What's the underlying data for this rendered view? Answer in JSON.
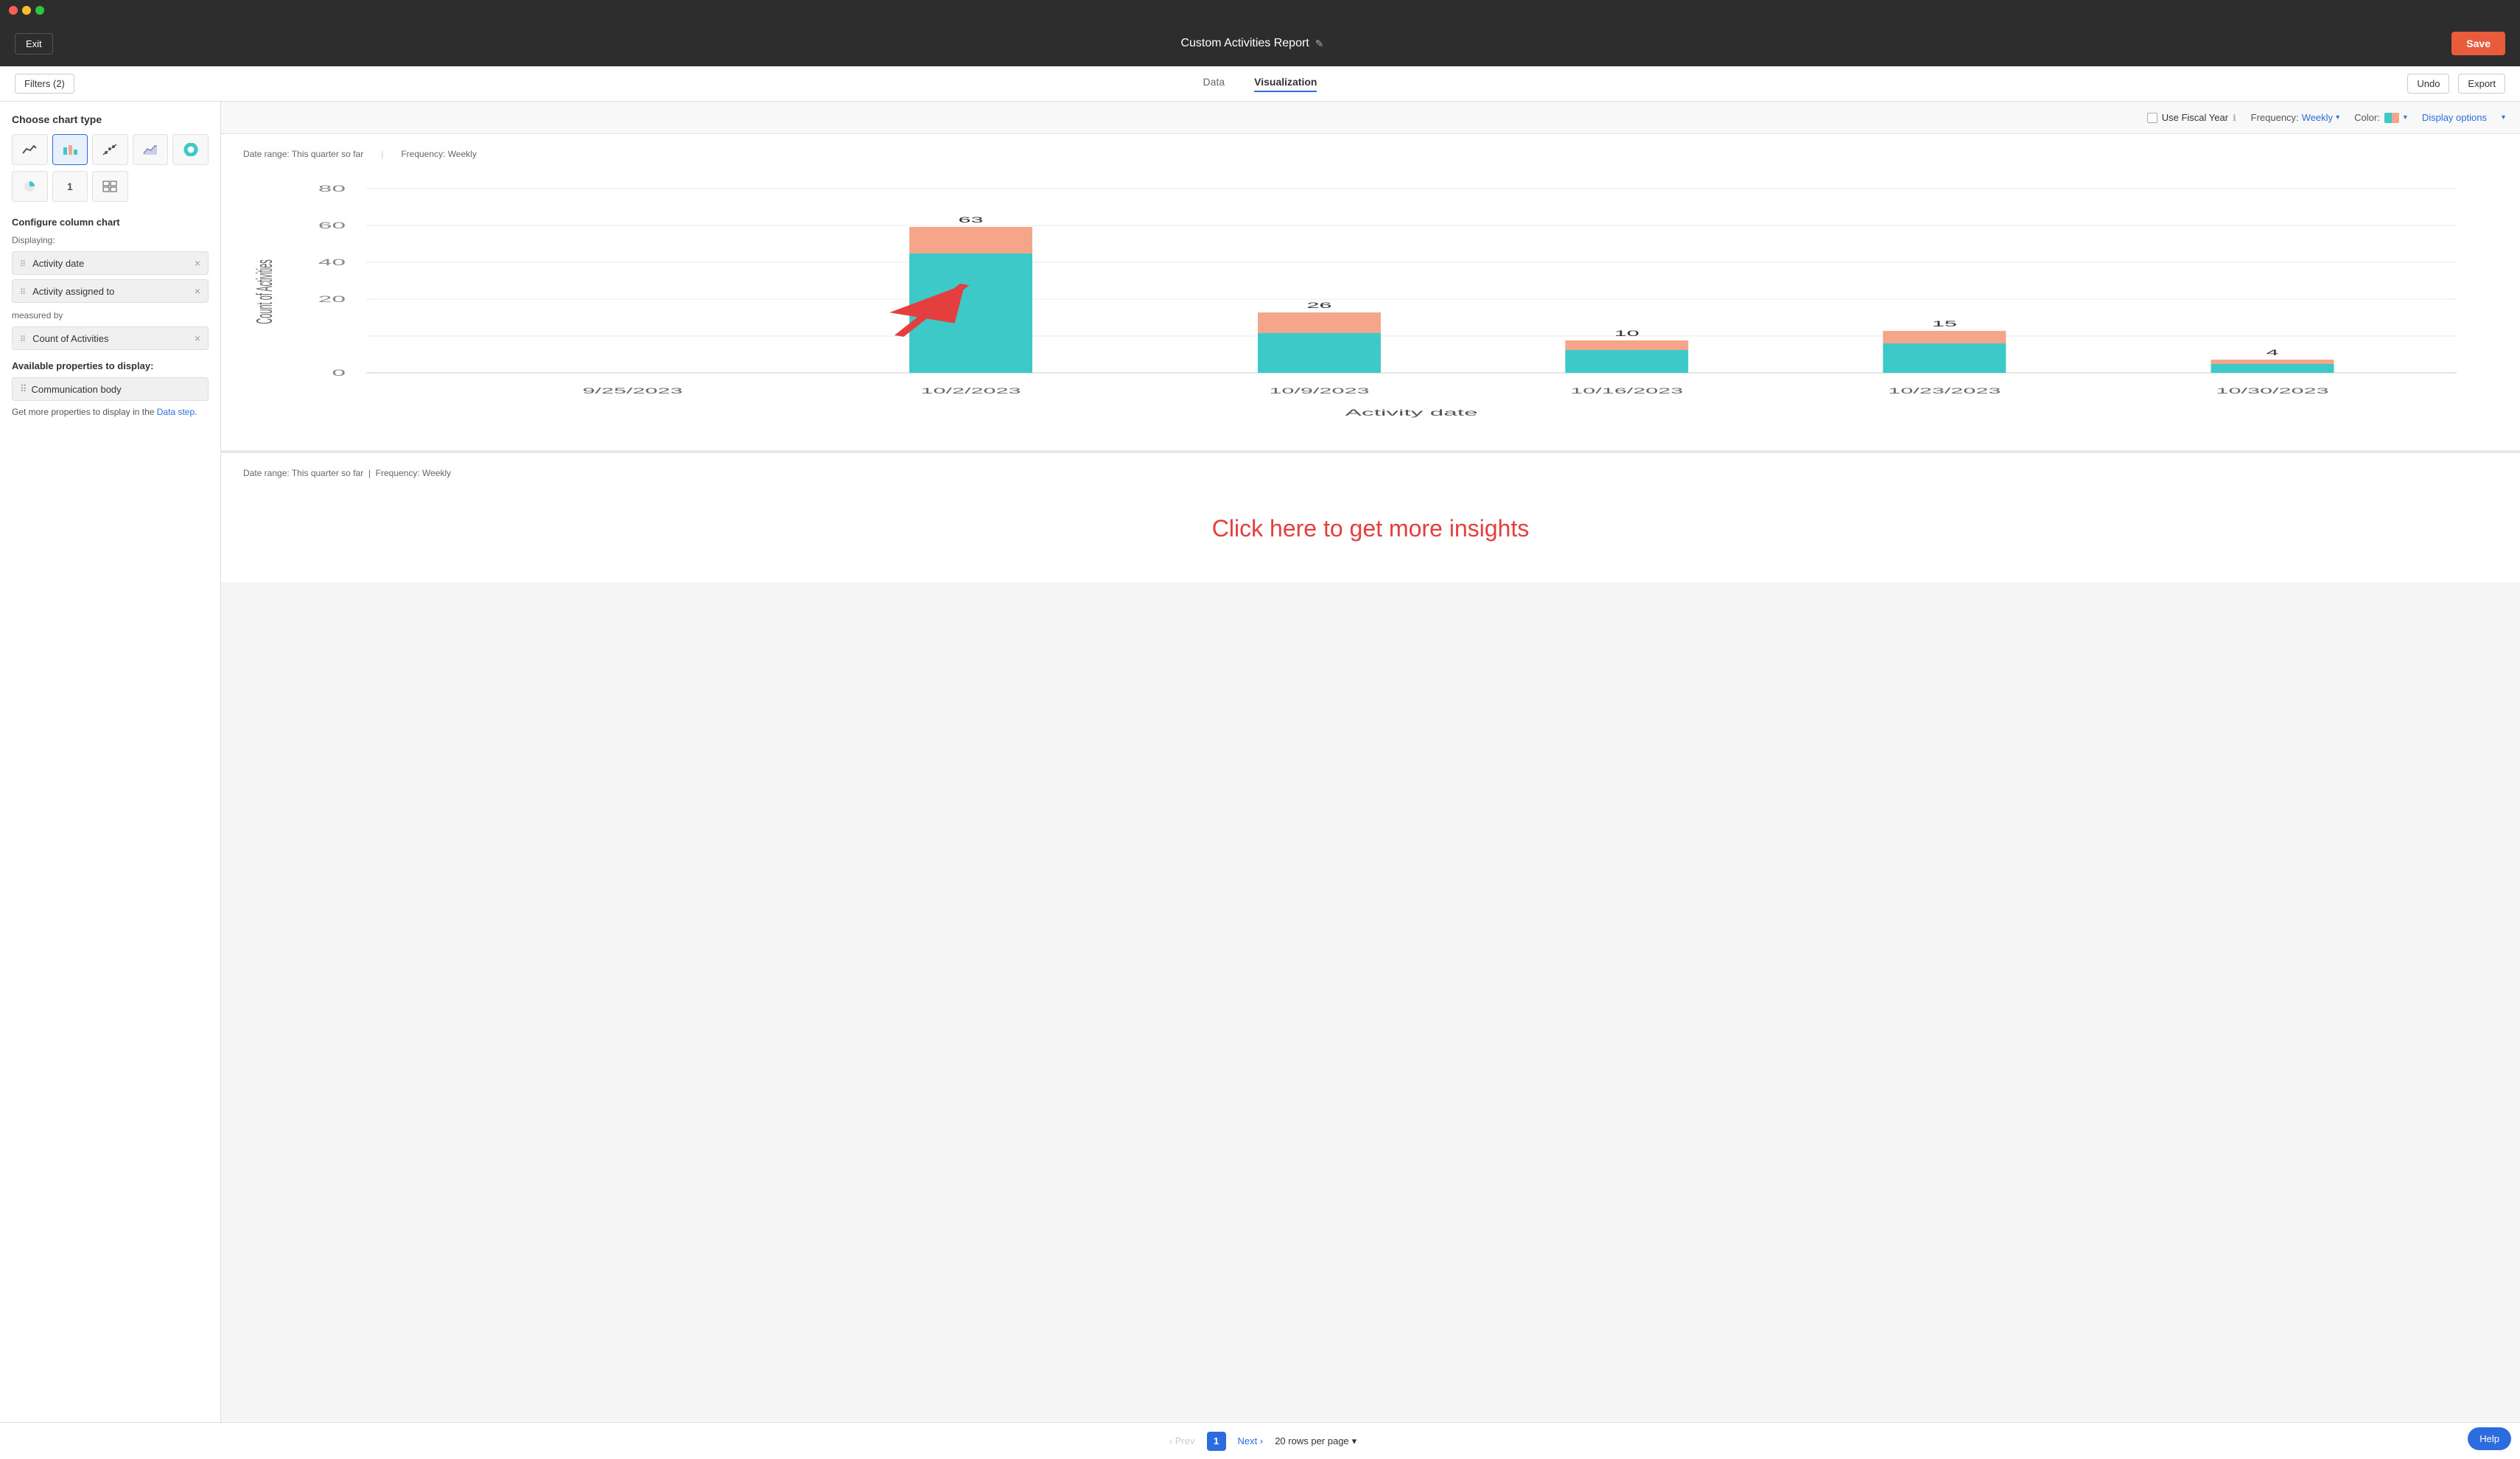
{
  "titlebar": {
    "red": "red",
    "yellow": "yellow",
    "green": "green"
  },
  "header": {
    "exit_label": "Exit",
    "title": "Custom Activities Report",
    "edit_icon": "✎",
    "save_label": "Save"
  },
  "tabbar": {
    "filter_label": "Filters (2)",
    "tabs": [
      {
        "id": "data",
        "label": "Data",
        "active": false
      },
      {
        "id": "visualization",
        "label": "Visualization",
        "active": true
      }
    ],
    "undo_label": "Undo",
    "export_label": "Export"
  },
  "sidebar": {
    "chart_type_section": "Choose chart type",
    "chart_types": [
      {
        "id": "line",
        "icon": "〰",
        "active": false
      },
      {
        "id": "bar",
        "icon": "▐",
        "active": true
      },
      {
        "id": "scatter",
        "icon": "✕",
        "active": false
      },
      {
        "id": "area",
        "icon": "◿",
        "active": false
      },
      {
        "id": "donut",
        "icon": "◎",
        "active": false
      },
      {
        "id": "pie",
        "icon": "◑",
        "active": false
      }
    ],
    "chart_types_row2": [
      {
        "id": "number",
        "icon": "1",
        "active": false
      },
      {
        "id": "grid",
        "icon": "⊞",
        "active": false
      }
    ],
    "configure_title": "Configure column chart",
    "displaying_label": "Displaying:",
    "display_fields": [
      {
        "id": "activity-date",
        "label": "Activity date"
      },
      {
        "id": "activity-assigned-to",
        "label": "Activity assigned to"
      }
    ],
    "measured_by_label": "measured by",
    "measure_fields": [
      {
        "id": "count-of-activities",
        "label": "Count of Activities"
      }
    ],
    "available_title": "Available properties to display:",
    "available_fields": [
      {
        "id": "communication-body",
        "label": "Communication body"
      }
    ],
    "data_step_text": "Get more properties to display in the ",
    "data_step_link": "Data step",
    "data_step_suffix": "."
  },
  "chart_options": {
    "fiscal_year_label": "Use Fiscal Year",
    "info_icon": "ℹ",
    "frequency_label": "Frequency:",
    "frequency_value": "Weekly",
    "color_label": "Color:",
    "display_options_label": "Display options"
  },
  "chart": {
    "date_range": "Date range: This quarter so far",
    "frequency": "Frequency: Weekly",
    "y_ticks": [
      "80",
      "60",
      "40",
      "20",
      "0"
    ],
    "y_axis_label": "Count of Activities",
    "x_axis_label": "Activity date",
    "bars": [
      {
        "date": "9/25/2023",
        "value": null,
        "teal_height": 0,
        "salmon_height": 0
      },
      {
        "date": "10/2/2023",
        "value": 63,
        "teal_height": 160,
        "salmon_height": 60
      },
      {
        "date": "10/9/2023",
        "value": 26,
        "teal_height": 70,
        "salmon_height": 45
      },
      {
        "date": "10/16/2023",
        "value": 10,
        "teal_height": 30,
        "salmon_height": 18
      },
      {
        "date": "10/23/2023",
        "value": 15,
        "teal_height": 42,
        "salmon_height": 22
      },
      {
        "date": "10/30/2023",
        "value": 4,
        "teal_height": 10,
        "salmon_height": 8
      }
    ]
  },
  "insight": {
    "date_range": "Date range: This quarter so far",
    "frequency": "Frequency: Weekly",
    "cta_text": "Click here to get more insights"
  },
  "pagination": {
    "prev_label": "Prev",
    "page_num": "1",
    "next_label": "Next",
    "rows_label": "20 rows per page",
    "dropdown_arrow": "▾"
  },
  "help": {
    "label": "Help"
  }
}
